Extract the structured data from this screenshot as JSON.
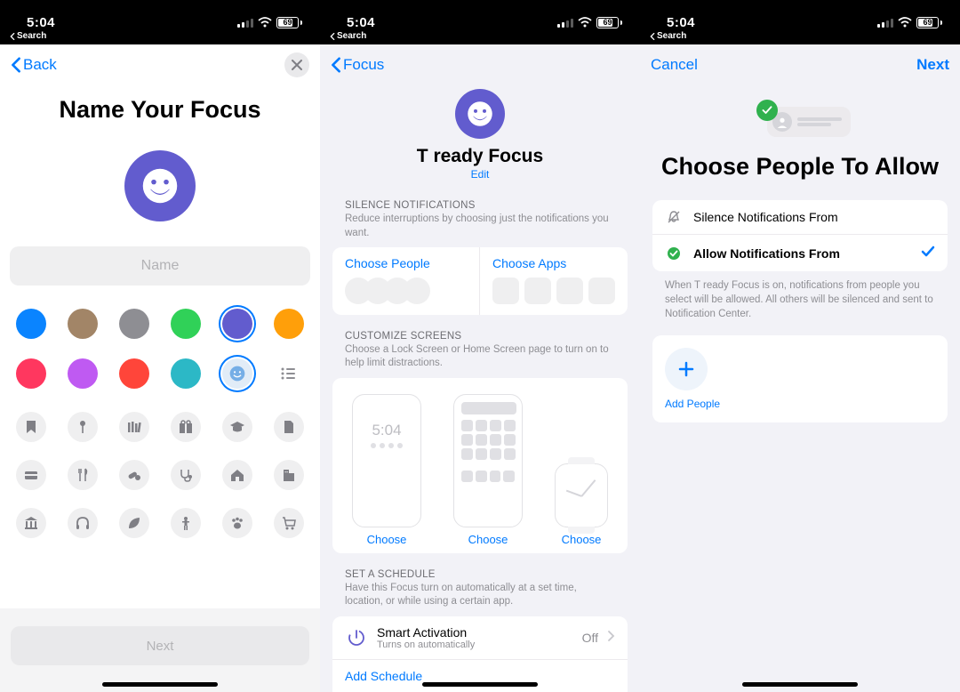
{
  "status": {
    "time": "5:04",
    "back_search": "Search",
    "battery": "69"
  },
  "screen1": {
    "nav_back": "Back",
    "title": "Name Your Focus",
    "name_placeholder": "Name",
    "colors": [
      "#0a84ff",
      "#a28567",
      "#8e8e93",
      "#30d158",
      "#625cce",
      "#ff9f0a",
      "#ff375f",
      "#bf5af2",
      "#ff453a",
      "#2cb8c6"
    ],
    "selected_color_index": 4,
    "icons": [
      "bookmark",
      "pin",
      "library",
      "gift",
      "graduation",
      "document",
      "card",
      "fork",
      "pills",
      "stethoscope",
      "house",
      "building",
      "bank",
      "headphones",
      "leaf",
      "person",
      "paw",
      "cart"
    ],
    "next": "Next"
  },
  "screen2": {
    "nav_back": "Focus",
    "focus_name": "T ready Focus",
    "edit": "Edit",
    "silence_h": "SILENCE NOTIFICATIONS",
    "silence_d": "Reduce interruptions by choosing just the notifications you want.",
    "choose_people": "Choose People",
    "choose_apps": "Choose Apps",
    "customize_h": "CUSTOMIZE SCREENS",
    "customize_d": "Choose a Lock Screen or Home Screen page to turn on to help limit distractions.",
    "lock_time": "5:04",
    "choose": "Choose",
    "schedule_h": "SET A SCHEDULE",
    "schedule_d": "Have this Focus turn on automatically at a set time, location, or while using a certain app.",
    "smart_title": "Smart Activation",
    "smart_sub": "Turns on automatically",
    "smart_state": "Off",
    "add_schedule": "Add Schedule"
  },
  "screen3": {
    "cancel": "Cancel",
    "next": "Next",
    "title": "Choose People To Allow",
    "opt_silence": "Silence Notifications From",
    "opt_allow": "Allow Notifications From",
    "desc": "When T ready Focus is on, notifications from people you select will be allowed. All others will be silenced and sent to Notification Center.",
    "add_people": "Add People"
  }
}
